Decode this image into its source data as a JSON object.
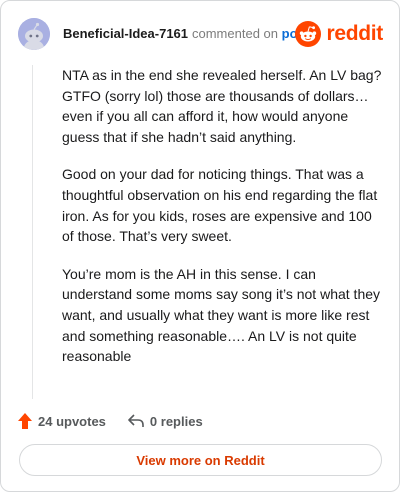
{
  "comment": {
    "username": "Beneficial-Idea-7161",
    "action_text": "commented on",
    "post_link": "post",
    "paragraphs": [
      "NTA as in the end she revealed herself. An LV bag? GTFO (sorry lol) those are thousands of dollars… even if you all can afford it, how would anyone guess that if she hadn’t said anything.",
      "Good on your dad for noticing things. That was a thoughtful observation on his end regarding the flat iron. As for you kids, roses are expensive and 100 of those. That’s very sweet.",
      "You’re mom is the AH in this sense. I can understand some moms say song it’s not what they want, and usually what they want is more like rest and something reasonable…. An LV is not quite reasonable"
    ],
    "upvotes": "24 upvotes",
    "replies": "0 replies"
  },
  "brand": {
    "name": "reddit",
    "color": "#ff4500",
    "icon": "reddit-logo-icon"
  },
  "footer": {
    "view_more_label": "View more on Reddit"
  },
  "colors": {
    "upvote": "#ff4500",
    "link": "#0a6cd6",
    "view_more_text": "#d93a00"
  }
}
